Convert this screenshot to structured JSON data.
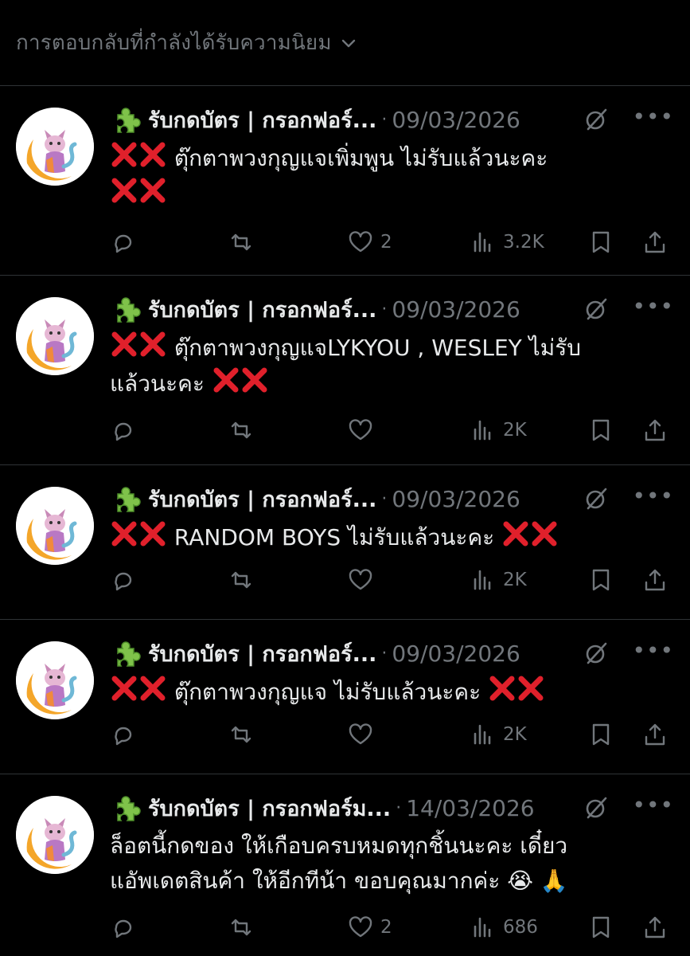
{
  "header": {
    "sort_label": "การตอบกลับที่กำลังได้รับความนิยม"
  },
  "colors": {
    "background": "#000000",
    "text": "#e7e9ea",
    "muted": "#71767b",
    "divider": "#2f3336",
    "cross": "#e0202b"
  },
  "posts": [
    {
      "author": "รับกดบัตร | กรอกฟอร์...",
      "separator": "·",
      "date": "09/03/2026",
      "text_parts": [
        "ตุ๊กตาพวงกุญแจเพิ่มพูน ไม่รับแล้วนะคะ"
      ],
      "more": "•••",
      "stats": {
        "replies": "",
        "reposts": "",
        "likes": "2",
        "views": "3.2K"
      }
    },
    {
      "author": "รับกดบัตร | กรอกฟอร์...",
      "separator": "·",
      "date": "09/03/2026",
      "text_parts": [
        "ตุ๊กตาพวงกุญแจLYKYOU , WESLEY ไม่รับ",
        "แล้วนะคะ"
      ],
      "more": "•••",
      "stats": {
        "replies": "",
        "reposts": "",
        "likes": "",
        "views": "2K"
      }
    },
    {
      "author": "รับกดบัตร | กรอกฟอร์...",
      "separator": "·",
      "date": "09/03/2026",
      "text_parts": [
        "RANDOM BOYS ไม่รับแล้วนะคะ"
      ],
      "more": "•••",
      "stats": {
        "replies": "",
        "reposts": "",
        "likes": "",
        "views": "2K"
      }
    },
    {
      "author": "รับกดบัตร | กรอกฟอร์...",
      "separator": "·",
      "date": "09/03/2026",
      "text_parts": [
        "ตุ๊กตาพวงกุญแจ ไม่รับแล้วนะคะ"
      ],
      "more": "•••",
      "stats": {
        "replies": "",
        "reposts": "",
        "likes": "",
        "views": "2K"
      }
    },
    {
      "author": "รับกดบัตร | กรอกฟอร์ม...",
      "separator": "·",
      "date": "14/03/2026",
      "text_parts": [
        "ล็อตนี้กดของ ให้เกือบครบหมดทุกชิ้นนะคะ เดี๋ยว",
        "แอัพเดตสินค้า ให้อีกทีน้า ขอบคุณมากค่ะ",
        "😭 🙏"
      ],
      "more": "•••",
      "stats": {
        "replies": "",
        "reposts": "",
        "likes": "2",
        "views": "686"
      }
    }
  ],
  "icons": {
    "header_chevron": "chevron-down-icon",
    "author_badge": "puzzle-piece-icon",
    "grok": "grok-icon",
    "reply": "reply-icon",
    "repost": "repost-icon",
    "like": "heart-icon",
    "views": "views-icon",
    "bookmark": "bookmark-icon",
    "share": "share-icon",
    "cross_mark": "cross-mark-icon"
  }
}
